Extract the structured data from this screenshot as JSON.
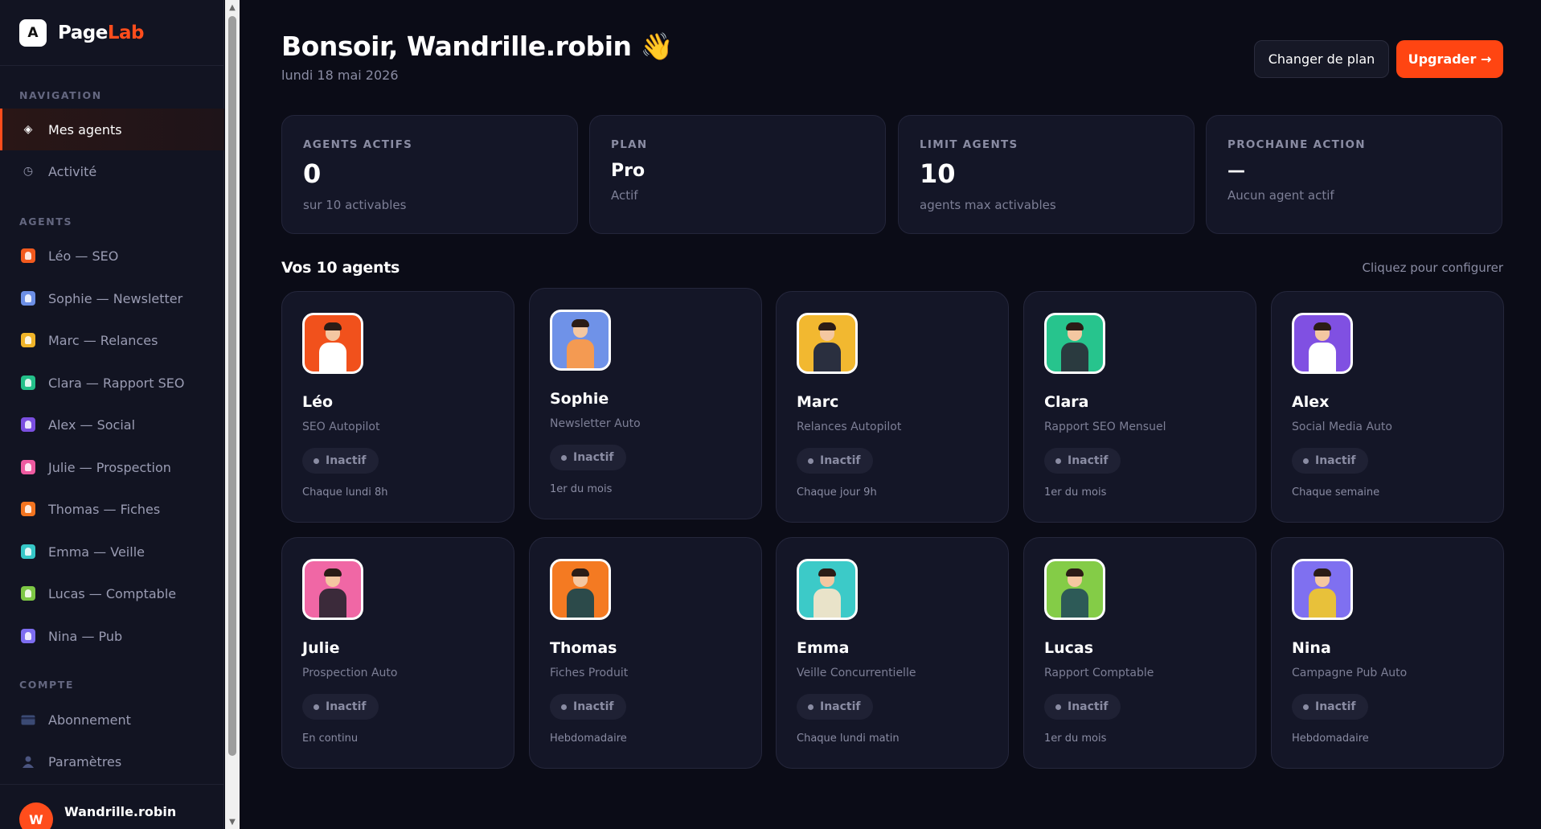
{
  "brand": {
    "name_part1": "Page",
    "name_part2": "Lab",
    "logo_glyph": "A",
    "accent": "#ff4d1c"
  },
  "sidebar": {
    "sections": {
      "navigation": "NAVIGATION",
      "agents": "AGENTS",
      "account": "COMPTE"
    },
    "nav": [
      {
        "label": "Mes agents",
        "icon": "diamond-icon",
        "active": true
      },
      {
        "label": "Activité",
        "icon": "clock-icon",
        "active": false
      }
    ],
    "agents": [
      {
        "label": "Léo — SEO",
        "color": "#f25a1e"
      },
      {
        "label": "Sophie — Newsletter",
        "color": "#6c8fe6"
      },
      {
        "label": "Marc — Relances",
        "color": "#f0b429"
      },
      {
        "label": "Clara — Rapport SEO",
        "color": "#24c08a"
      },
      {
        "label": "Alex — Social",
        "color": "#7b4fe0"
      },
      {
        "label": "Julie — Prospection",
        "color": "#ee5aa0"
      },
      {
        "label": "Thomas — Fiches",
        "color": "#f27420"
      },
      {
        "label": "Emma — Veille",
        "color": "#36c7c7"
      },
      {
        "label": "Lucas — Comptable",
        "color": "#7ec845"
      },
      {
        "label": "Nina — Pub",
        "color": "#7d6df0"
      }
    ],
    "account": [
      {
        "label": "Abonnement",
        "icon": "credit-card-icon"
      },
      {
        "label": "Paramètres",
        "icon": "user-icon"
      }
    ],
    "user": {
      "initial": "W",
      "name": "Wandrille.robin"
    }
  },
  "header": {
    "greeting": "Bonsoir, Wandrille.robin 👋",
    "date": "lundi 18 mai 2026",
    "change_plan": "Changer de plan",
    "upgrade": "Upgrader →"
  },
  "stats": [
    {
      "label": "AGENTS ACTIFS",
      "value": "0",
      "sub": "sur 10 activables"
    },
    {
      "label": "PLAN",
      "value": "Pro",
      "sub": "Actif"
    },
    {
      "label": "LIMIT AGENTS",
      "value": "10",
      "sub": "agents max activables"
    },
    {
      "label": "PROCHAINE ACTION",
      "value": "—",
      "sub": "Aucun agent actif"
    }
  ],
  "agents_section": {
    "title": "Vos 10 agents",
    "hint": "Cliquez pour configurer",
    "status_label": "Inactif",
    "cards": [
      {
        "name": "Léo",
        "desc": "SEO Autopilot",
        "schedule": "Chaque lundi 8h",
        "bg": "#f1511c",
        "shirt": "#ffffff"
      },
      {
        "name": "Sophie",
        "desc": "Newsletter Auto",
        "schedule": "1er du mois",
        "bg": "#6f92e8",
        "shirt": "#f49a52"
      },
      {
        "name": "Marc",
        "desc": "Relances Autopilot",
        "schedule": "Chaque jour 9h",
        "bg": "#f2b830",
        "shirt": "#2a2f3f"
      },
      {
        "name": "Clara",
        "desc": "Rapport SEO Mensuel",
        "schedule": "1er du mois",
        "bg": "#27c48d",
        "shirt": "#2a3a3f"
      },
      {
        "name": "Alex",
        "desc": "Social Media Auto",
        "schedule": "Chaque semaine",
        "bg": "#8050e2",
        "shirt": "#ffffff"
      },
      {
        "name": "Julie",
        "desc": "Prospection Auto",
        "schedule": "En continu",
        "bg": "#f067a5",
        "shirt": "#3b2a3a"
      },
      {
        "name": "Thomas",
        "desc": "Fiches Produit",
        "schedule": "Hebdomadaire",
        "bg": "#f47a22",
        "shirt": "#2c4a4a"
      },
      {
        "name": "Emma",
        "desc": "Veille Concurrentielle",
        "schedule": "Chaque lundi matin",
        "bg": "#3ccac8",
        "shirt": "#e9e3c9"
      },
      {
        "name": "Lucas",
        "desc": "Rapport Comptable",
        "schedule": "1er du mois",
        "bg": "#84cc47",
        "shirt": "#2d5a57"
      },
      {
        "name": "Nina",
        "desc": "Campagne Pub Auto",
        "schedule": "Hebdomadaire",
        "bg": "#7f70f0",
        "shirt": "#e8c13a"
      }
    ]
  }
}
